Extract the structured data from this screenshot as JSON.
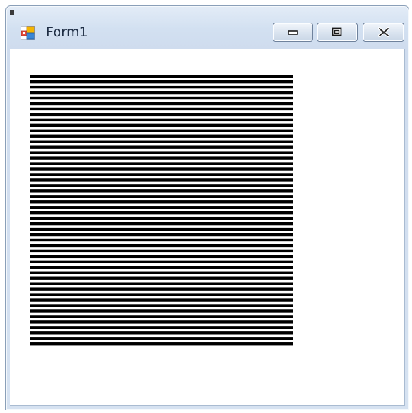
{
  "window": {
    "title": "Form1",
    "icons": {
      "app": "windows-forms-app-icon",
      "minimize": "minimize-icon",
      "maximize": "maximize-icon",
      "close": "close-icon"
    }
  },
  "canvas": {
    "graphic": "horizontal-stripes",
    "line_count": 50,
    "line_color": "#000000",
    "background": "#ffffff"
  },
  "colors": {
    "titlebar": "#d2e0f1",
    "client": "#ffffff",
    "frame_border": "#8a9fb8"
  }
}
